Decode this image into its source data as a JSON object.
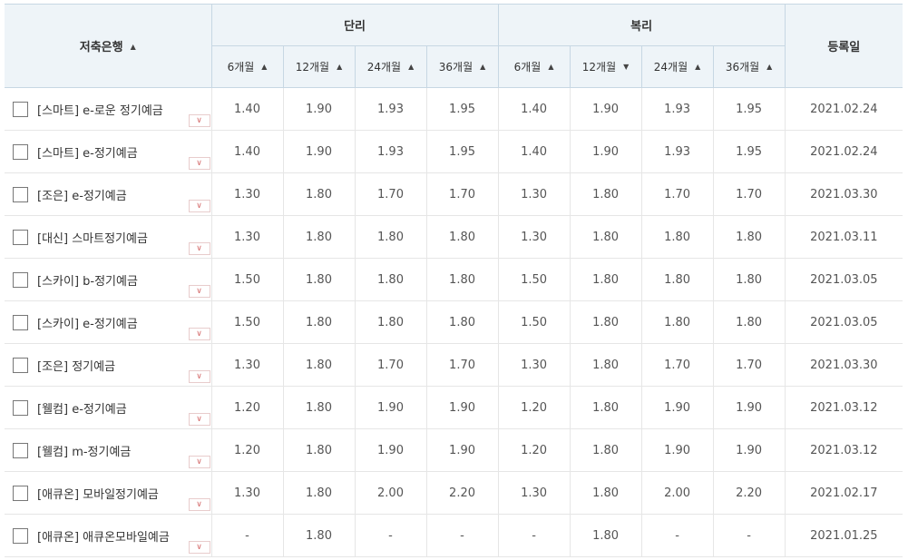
{
  "header": {
    "bank_col": "저축은행",
    "simple": "단리",
    "compound": "복리",
    "registered": "등록일",
    "simple_terms": [
      "6개월",
      "12개월",
      "24개월",
      "36개월"
    ],
    "compound_terms": [
      "6개월",
      "12개월",
      "24개월",
      "36개월"
    ],
    "sort_arrows": {
      "bank": "▲",
      "simple": [
        "▲",
        "▲",
        "▲",
        "▲"
      ],
      "compound": [
        "▲",
        "▼",
        "▲",
        "▲"
      ]
    }
  },
  "icons": {
    "checkbox": "checkbox-icon",
    "expand": "chevron-down-icon",
    "expand_glyph": "∨"
  },
  "colors": {
    "header_bg": "#eef4f8",
    "border": "#c7d7e3",
    "expand_accent": "#d46a6a"
  },
  "rows": [
    {
      "name": "[스마트] e-로운 정기예금",
      "simple": [
        "1.40",
        "1.90",
        "1.93",
        "1.95"
      ],
      "compound": [
        "1.40",
        "1.90",
        "1.93",
        "1.95"
      ],
      "date": "2021.02.24"
    },
    {
      "name": "[스마트] e-정기예금",
      "simple": [
        "1.40",
        "1.90",
        "1.93",
        "1.95"
      ],
      "compound": [
        "1.40",
        "1.90",
        "1.93",
        "1.95"
      ],
      "date": "2021.02.24"
    },
    {
      "name": "[조은] e-정기예금",
      "simple": [
        "1.30",
        "1.80",
        "1.70",
        "1.70"
      ],
      "compound": [
        "1.30",
        "1.80",
        "1.70",
        "1.70"
      ],
      "date": "2021.03.30"
    },
    {
      "name": "[대신] 스마트정기예금",
      "simple": [
        "1.30",
        "1.80",
        "1.80",
        "1.80"
      ],
      "compound": [
        "1.30",
        "1.80",
        "1.80",
        "1.80"
      ],
      "date": "2021.03.11"
    },
    {
      "name": "[스카이] b-정기예금",
      "simple": [
        "1.50",
        "1.80",
        "1.80",
        "1.80"
      ],
      "compound": [
        "1.50",
        "1.80",
        "1.80",
        "1.80"
      ],
      "date": "2021.03.05"
    },
    {
      "name": "[스카이] e-정기예금",
      "simple": [
        "1.50",
        "1.80",
        "1.80",
        "1.80"
      ],
      "compound": [
        "1.50",
        "1.80",
        "1.80",
        "1.80"
      ],
      "date": "2021.03.05"
    },
    {
      "name": "[조은] 정기예금",
      "simple": [
        "1.30",
        "1.80",
        "1.70",
        "1.70"
      ],
      "compound": [
        "1.30",
        "1.80",
        "1.70",
        "1.70"
      ],
      "date": "2021.03.30"
    },
    {
      "name": "[웰컴] e-정기예금",
      "simple": [
        "1.20",
        "1.80",
        "1.90",
        "1.90"
      ],
      "compound": [
        "1.20",
        "1.80",
        "1.90",
        "1.90"
      ],
      "date": "2021.03.12"
    },
    {
      "name": "[웰컴] m-정기예금",
      "simple": [
        "1.20",
        "1.80",
        "1.90",
        "1.90"
      ],
      "compound": [
        "1.20",
        "1.80",
        "1.90",
        "1.90"
      ],
      "date": "2021.03.12"
    },
    {
      "name": "[애큐온] 모바일정기예금",
      "simple": [
        "1.30",
        "1.80",
        "2.00",
        "2.20"
      ],
      "compound": [
        "1.30",
        "1.80",
        "2.00",
        "2.20"
      ],
      "date": "2021.02.17"
    },
    {
      "name": "[애큐온] 애큐온모바일예금",
      "simple": [
        "-",
        "1.80",
        "-",
        "-"
      ],
      "compound": [
        "-",
        "1.80",
        "-",
        "-"
      ],
      "date": "2021.01.25"
    }
  ]
}
